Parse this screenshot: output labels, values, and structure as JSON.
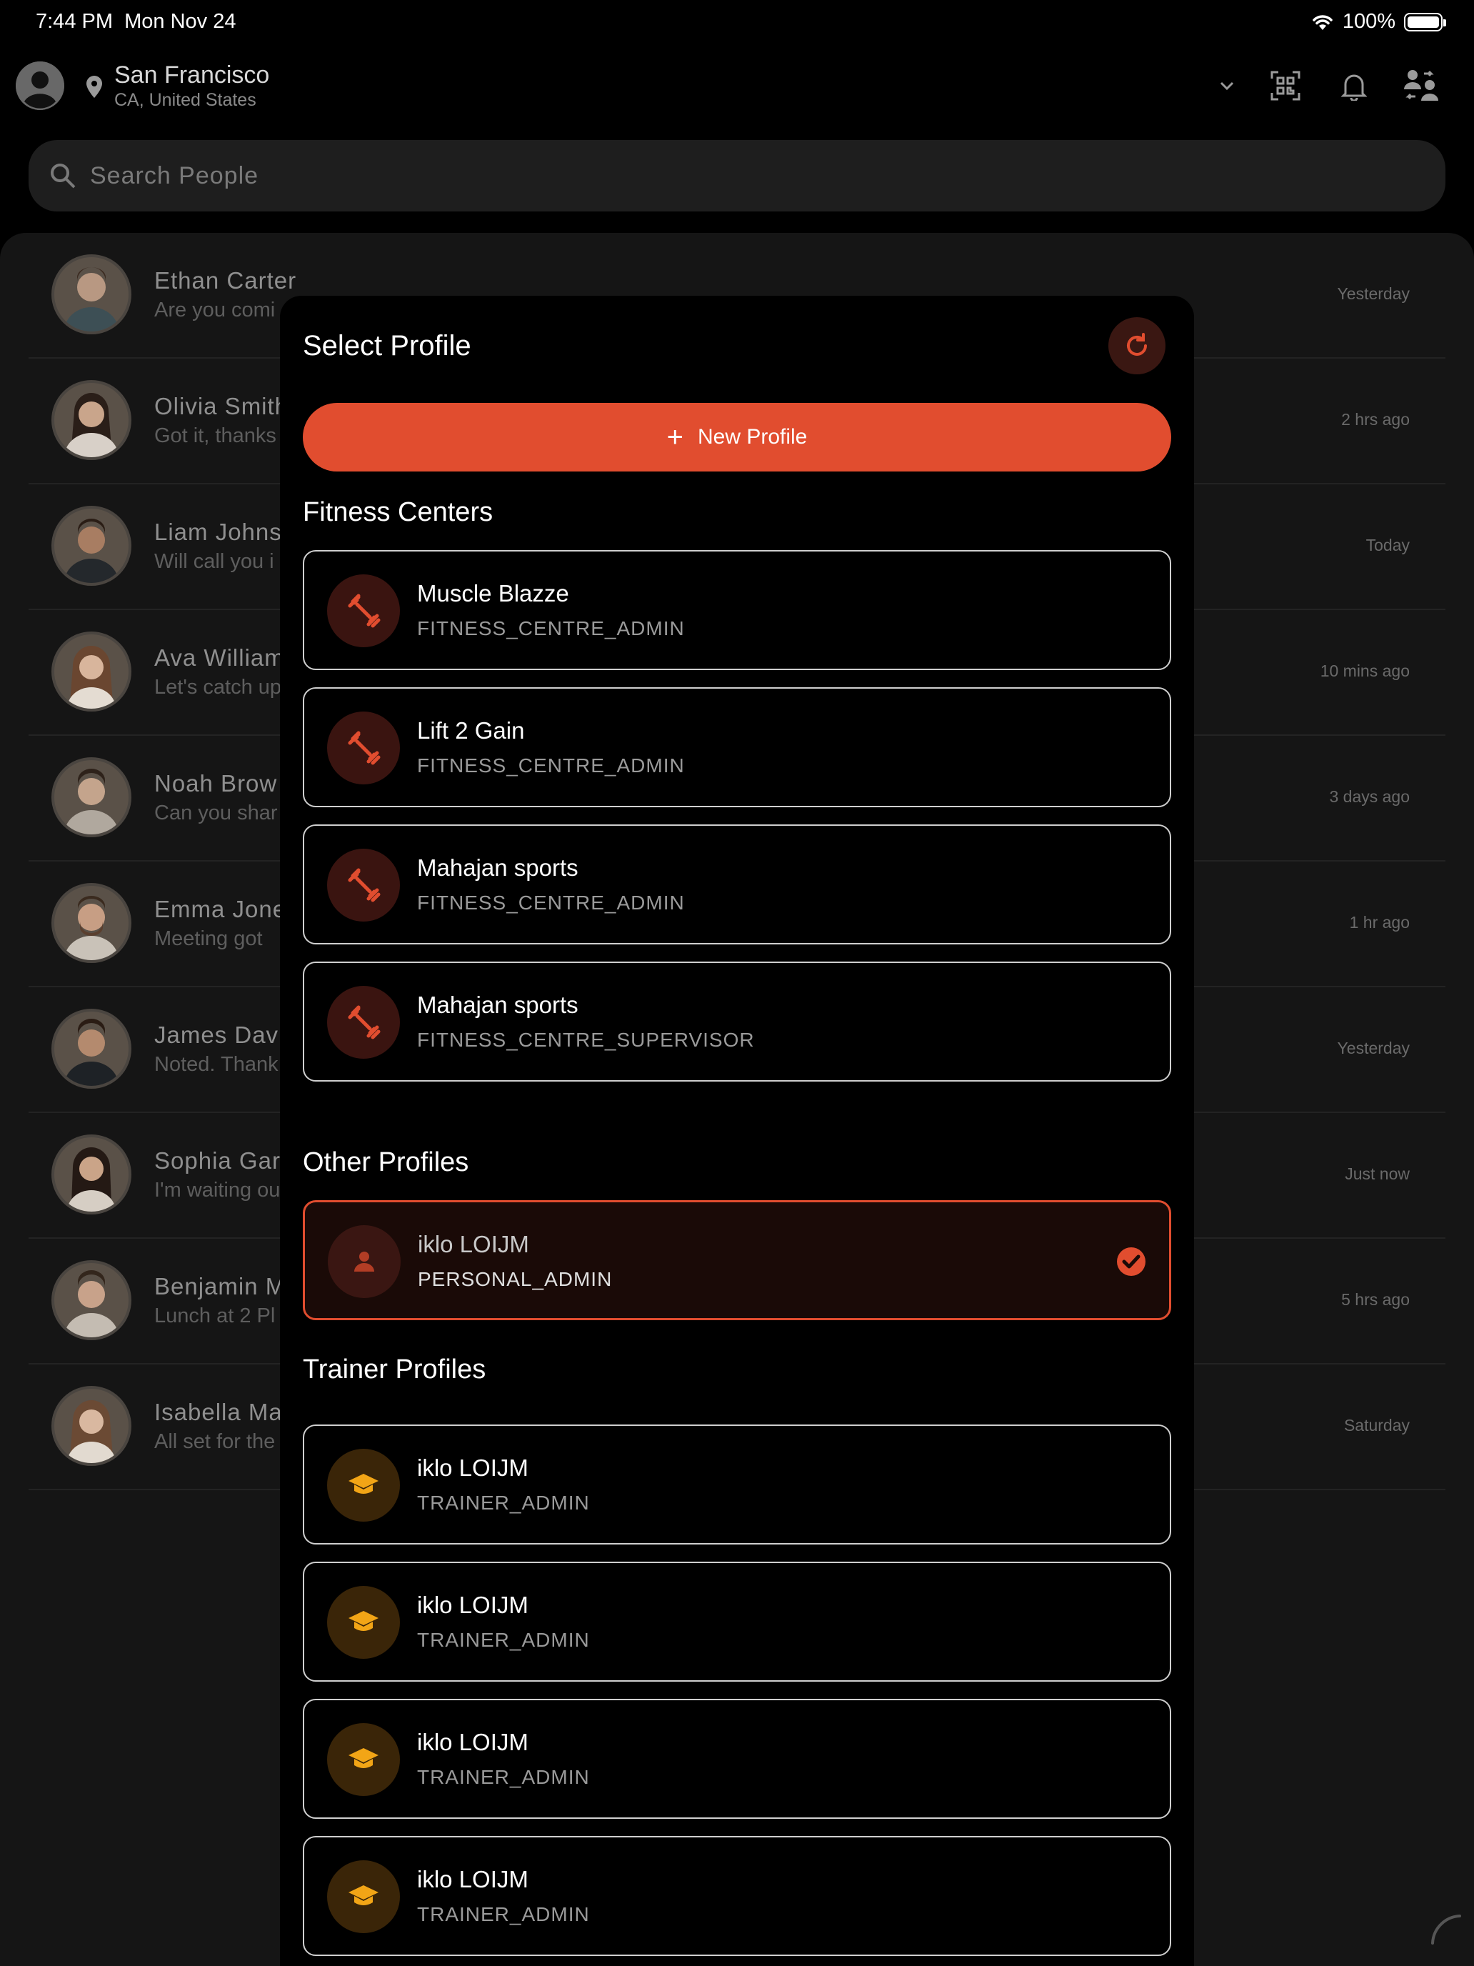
{
  "status": {
    "time": "7:44 PM",
    "date": "Mon Nov 24",
    "battery": "100%",
    "battery_level": 1.0
  },
  "header": {
    "city": "San Francisco",
    "region": "CA, United States",
    "icons": [
      "account-circle-icon",
      "location-pin-icon",
      "chevron-down-icon",
      "qr-scan-icon",
      "bell-icon",
      "switch-profile-icon"
    ]
  },
  "search": {
    "placeholder": "Search People"
  },
  "chats": [
    {
      "name": "Ethan Carter",
      "message": "Are you comi",
      "time": "Yesterday"
    },
    {
      "name": "Olivia Smith",
      "message": "Got it, thanks",
      "time": "2 hrs ago"
    },
    {
      "name": "Liam Johns",
      "message": "Will call you i",
      "time": "Today"
    },
    {
      "name": "Ava William",
      "message": "Let's catch up",
      "time": "10 mins ago"
    },
    {
      "name": "Noah Brow",
      "message": "Can you shar",
      "time": "3 days ago"
    },
    {
      "name": "Emma Jone",
      "message": "Meeting got",
      "time": "1 hr ago"
    },
    {
      "name": "James Dav",
      "message": "Noted. Thank",
      "time": "Yesterday"
    },
    {
      "name": "Sophia Gar",
      "message": "I'm waiting ou",
      "time": "Just now"
    },
    {
      "name": "Benjamin M",
      "message": "Lunch at 2 Pl",
      "time": "5 hrs ago"
    },
    {
      "name": "Isabella Ma",
      "message": "All set for the",
      "time": "Saturday"
    }
  ],
  "modal": {
    "title": "Select Profile",
    "new_profile_label": "New Profile",
    "accent": "#e14d2f",
    "sections": {
      "fitness": {
        "title": "Fitness Centers",
        "items": [
          {
            "name": "Muscle Blazze",
            "role": "FITNESS_CENTRE_ADMIN"
          },
          {
            "name": "Lift 2 Gain",
            "role": "FITNESS_CENTRE_ADMIN"
          },
          {
            "name": "Mahajan sports",
            "role": "FITNESS_CENTRE_ADMIN"
          },
          {
            "name": "Mahajan sports",
            "role": "FITNESS_CENTRE_SUPERVISOR"
          }
        ]
      },
      "other": {
        "title": "Other Profiles",
        "items": [
          {
            "name": "iklo LOIJM",
            "role": "PERSONAL_ADMIN",
            "selected": true
          }
        ]
      },
      "trainer": {
        "title": "Trainer Profiles",
        "items": [
          {
            "name": "iklo LOIJM",
            "role": "TRAINER_ADMIN"
          },
          {
            "name": "iklo LOIJM",
            "role": "TRAINER_ADMIN"
          },
          {
            "name": "iklo LOIJM",
            "role": "TRAINER_ADMIN"
          },
          {
            "name": "iklo LOIJM",
            "role": "TRAINER_ADMIN"
          }
        ]
      }
    }
  }
}
